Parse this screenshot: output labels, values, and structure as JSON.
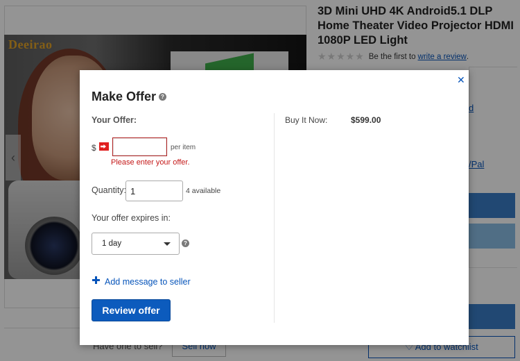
{
  "background": {
    "image_brand": "Deeirao",
    "gallery_prev_glyph": "‹",
    "product_title": "3D Mini UHD 4K Android5.1 DLP Home Theater Video Projector HDMI 1080P LED Light",
    "rating": {
      "stars": "★★★★★",
      "prefix": "Be the first to",
      "link": "write a review",
      "suffix": "."
    },
    "side_link_a": "d",
    "side_link_b": "/Pal",
    "sell_text": "Have one to sell?",
    "sell_button": "Sell now",
    "watchlist_button": "♡ Add to watchlist"
  },
  "modal": {
    "title": "Make Offer",
    "help_glyph": "?",
    "close_glyph": "✕",
    "your_offer_label": "Your Offer:",
    "currency": "$",
    "offer_value": "",
    "per_item": "per item",
    "error": "Please enter your offer.",
    "quantity_label": "Quantity:",
    "quantity_value": "1",
    "available": "4 available",
    "expires_label": "Your offer expires in:",
    "expires_value": "1 day",
    "add_message": "Add message to seller",
    "review_button": "Review offer",
    "buy_it_now_label": "Buy It Now:",
    "buy_it_now_price": "$599.00"
  },
  "colors": {
    "accent": "#0654ba",
    "primary_button": "#0c5bbd",
    "error": "#c41818"
  }
}
